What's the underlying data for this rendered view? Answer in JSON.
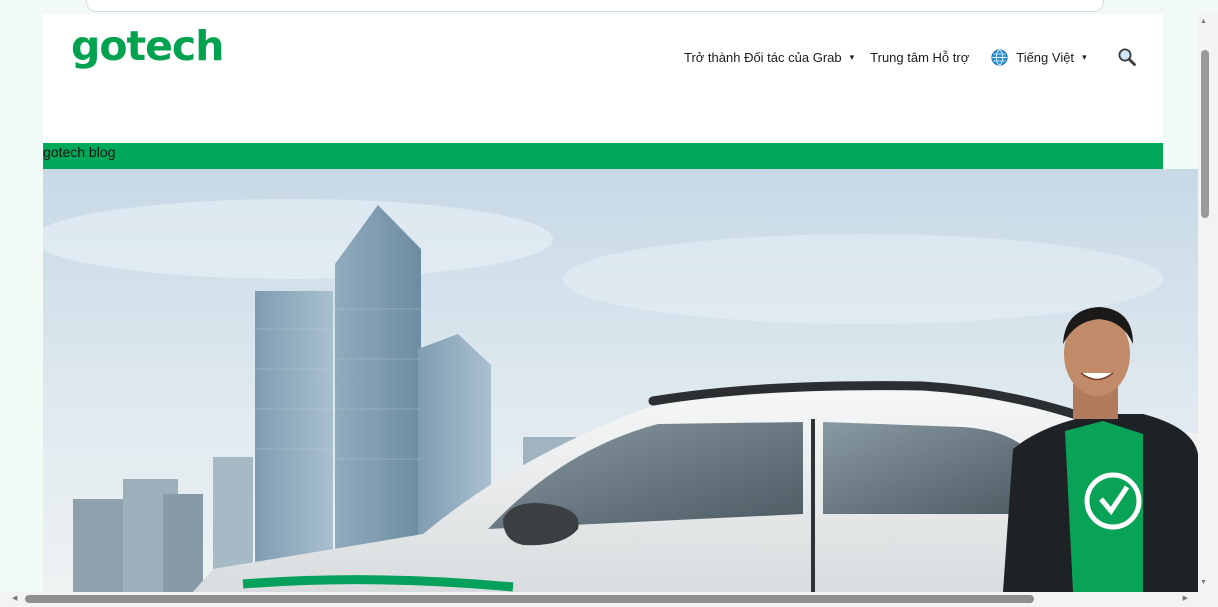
{
  "brand": {
    "logo_text": "gotech",
    "color": "#00a250"
  },
  "nav": {
    "partner": "Trở thành Đối tác của Grab",
    "support": "Trung tâm Hỗ trợ",
    "language": "Tiếng Việt",
    "caret": "▾"
  },
  "banner": {
    "label": "gotech blog",
    "color": "#00a85a"
  },
  "hero": {
    "image": "hero-car-city-driver"
  },
  "icons": {
    "language": "globe-icon",
    "search": "search-icon"
  }
}
